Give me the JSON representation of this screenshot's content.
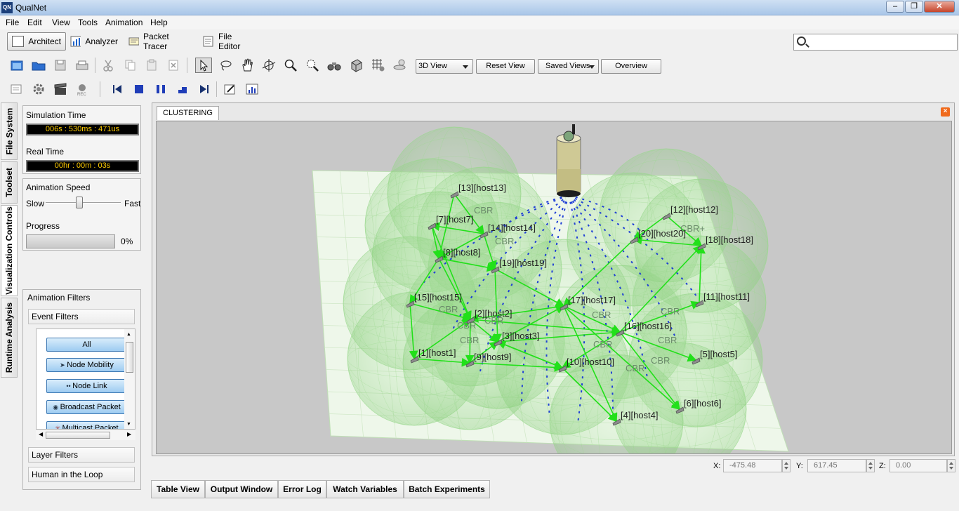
{
  "window": {
    "title": "QualNet",
    "logo_text": "QN"
  },
  "menu": [
    "File",
    "Edit",
    "View",
    "Tools",
    "Animation",
    "Help"
  ],
  "modes": {
    "architect": "Architect",
    "analyzer": "Analyzer",
    "packet_tracer": "Packet Tracer",
    "file_editor": "File Editor"
  },
  "search": {
    "value": "",
    "placeholder": ""
  },
  "view_toolbar": {
    "view_mode": "3D View",
    "reset_view": "Reset View",
    "saved_views": "Saved Views",
    "overview": "Overview"
  },
  "side_tabs": [
    "File System",
    "Toolset",
    "Visualization Controls",
    "Runtime Analysis"
  ],
  "viz": {
    "sim_time_label": "Simulation Time",
    "sim_time_value": "006s : 530ms : 471us",
    "real_time_label": "Real Time",
    "real_time_value": "00hr : 00m : 03s",
    "anim_speed_label": "Animation Speed",
    "slow": "Slow",
    "fast": "Fast",
    "progress_label": "Progress",
    "progress_value": "0%",
    "progress_fraction": 0,
    "speed_fraction": 0.45
  },
  "filters": {
    "title": "Animation Filters",
    "event_filters": "Event Filters",
    "buttons": [
      "All",
      "Node Mobility",
      "Node Link",
      "Broadcast Packet",
      "Multicast Packet"
    ],
    "layer_filters": "Layer Filters",
    "hitl": "Human in the Loop"
  },
  "scenario": {
    "tab": "CLUSTERING",
    "cbr_label": "CBR",
    "cbr_plus_label": "CBR+"
  },
  "nodes": [
    {
      "label": "[13][host13]"
    },
    {
      "label": "[14][host14]"
    },
    {
      "label": "[7][host7]"
    },
    {
      "label": "[8][host8]"
    },
    {
      "label": "[19][host19]"
    },
    {
      "label": "[12][host12]"
    },
    {
      "label": "[20][host20]"
    },
    {
      "label": "[18][host18]"
    },
    {
      "label": "[11][host11]"
    },
    {
      "label": "[15][host15]"
    },
    {
      "label": "[17][host17]"
    },
    {
      "label": "[16][host16]"
    },
    {
      "label": "[2][host2]"
    },
    {
      "label": "[3][host3]"
    },
    {
      "label": "[1][host1]"
    },
    {
      "label": "[9][host9]"
    },
    {
      "label": "[10][host10]"
    },
    {
      "label": "[5][host5]"
    },
    {
      "label": "[6][host6]"
    },
    {
      "label": "[4][host4]"
    }
  ],
  "coords": {
    "x_label": "X:",
    "x": "-475.48",
    "y_label": "Y:",
    "y": "617.45",
    "z_label": "Z:",
    "z": "0.00"
  },
  "bottom_tabs": [
    "Table View",
    "Output Window",
    "Error Log",
    "Watch Variables",
    "Batch Experiments"
  ],
  "colors": {
    "link": "#22e01a",
    "coverage": "#9ad98e",
    "orbit": "#1f3fd6",
    "lcd_text": "#ffcc00"
  }
}
